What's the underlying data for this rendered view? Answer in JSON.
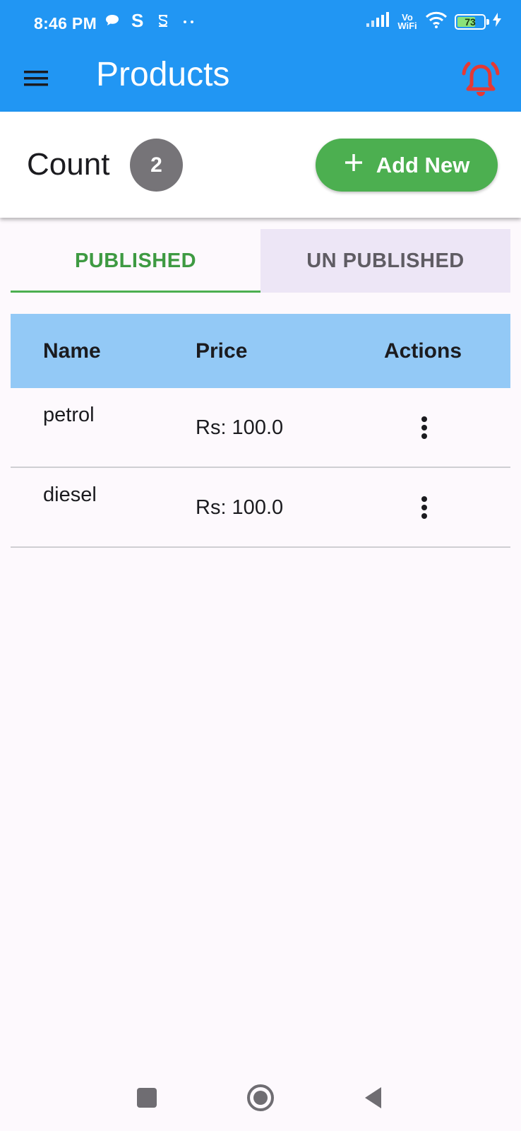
{
  "status_bar": {
    "time": "8:46 PM",
    "network_label": "Vo WiFi",
    "battery_level": "73"
  },
  "app_bar": {
    "title": "Products",
    "menu_icon": "menu-icon",
    "alert_icon": "bell-alert-icon"
  },
  "count_bar": {
    "label": "Count",
    "count": "2",
    "add_button_label": "Add New",
    "add_icon": "plus-icon"
  },
  "tabs": [
    {
      "label": "PUBLISHED",
      "active": true
    },
    {
      "label": "UN PUBLISHED",
      "active": false
    }
  ],
  "table": {
    "headers": [
      "Name",
      "Price",
      "Actions"
    ],
    "rows": [
      {
        "name": "petrol",
        "price": "Rs: 100.0"
      },
      {
        "name": "diesel",
        "price": "Rs: 100.0"
      }
    ]
  },
  "colors": {
    "app_bar": "#2196F3",
    "accent_green": "#4CAF50",
    "alert_red": "#E53935",
    "table_header": "#93C9F6",
    "inactive_tab": "#EDE6F6"
  },
  "nav_bar": {
    "icons": [
      "recents-square-icon",
      "home-circle-icon",
      "back-triangle-icon"
    ]
  }
}
